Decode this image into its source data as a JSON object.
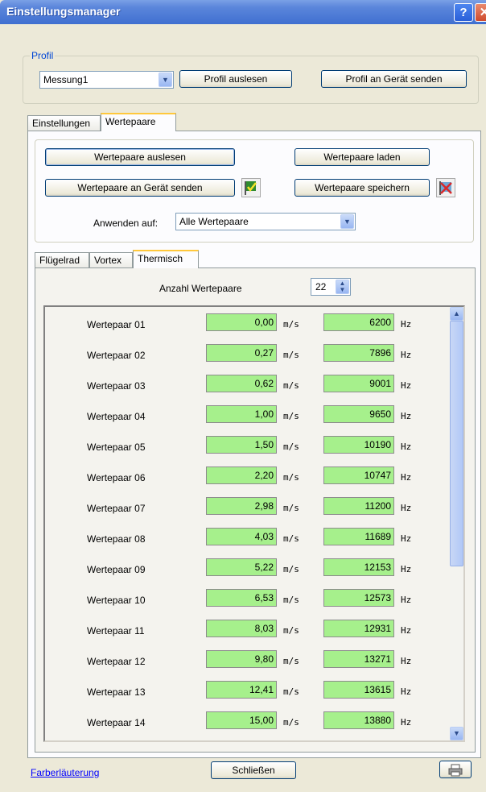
{
  "window": {
    "title": "Einstellungsmanager",
    "help_label": "?",
    "close_label": "✕"
  },
  "profile": {
    "legend": "Profil",
    "selected": "Messung1",
    "read_button": "Profil auslesen",
    "send_button": "Profil an Gerät senden"
  },
  "tabs": [
    {
      "label": "Einstellungen"
    },
    {
      "label": "Wertepaare"
    }
  ],
  "wertepaare": {
    "read_button": "Wertepaare auslesen",
    "load_button": "Wertepaare laden",
    "send_button": "Wertepaare an Gerät senden",
    "save_button": "Wertepaare speichern",
    "apply_label": "Anwenden auf:",
    "apply_value": "Alle Wertepaare"
  },
  "subtabs": [
    {
      "label": "Flügelrad"
    },
    {
      "label": "Vortex"
    },
    {
      "label": "Thermisch"
    }
  ],
  "thermisch": {
    "count_label": "Anzahl Wertepaare",
    "count_value": "22",
    "rows": [
      {
        "label": "Wertepaar 01",
        "v1": "0,00",
        "u1": "m/s",
        "v2": "6200",
        "u2": "Hz"
      },
      {
        "label": "Wertepaar 02",
        "v1": "0,27",
        "u1": "m/s",
        "v2": "7896",
        "u2": "Hz"
      },
      {
        "label": "Wertepaar 03",
        "v1": "0,62",
        "u1": "m/s",
        "v2": "9001",
        "u2": "Hz"
      },
      {
        "label": "Wertepaar 04",
        "v1": "1,00",
        "u1": "m/s",
        "v2": "9650",
        "u2": "Hz"
      },
      {
        "label": "Wertepaar 05",
        "v1": "1,50",
        "u1": "m/s",
        "v2": "10190",
        "u2": "Hz"
      },
      {
        "label": "Wertepaar 06",
        "v1": "2,20",
        "u1": "m/s",
        "v2": "10747",
        "u2": "Hz"
      },
      {
        "label": "Wertepaar 07",
        "v1": "2,98",
        "u1": "m/s",
        "v2": "11200",
        "u2": "Hz"
      },
      {
        "label": "Wertepaar 08",
        "v1": "4,03",
        "u1": "m/s",
        "v2": "11689",
        "u2": "Hz"
      },
      {
        "label": "Wertepaar 09",
        "v1": "5,22",
        "u1": "m/s",
        "v2": "12153",
        "u2": "Hz"
      },
      {
        "label": "Wertepaar 10",
        "v1": "6,53",
        "u1": "m/s",
        "v2": "12573",
        "u2": "Hz"
      },
      {
        "label": "Wertepaar 11",
        "v1": "8,03",
        "u1": "m/s",
        "v2": "12931",
        "u2": "Hz"
      },
      {
        "label": "Wertepaar 12",
        "v1": "9,80",
        "u1": "m/s",
        "v2": "13271",
        "u2": "Hz"
      },
      {
        "label": "Wertepaar 13",
        "v1": "12,41",
        "u1": "m/s",
        "v2": "13615",
        "u2": "Hz"
      },
      {
        "label": "Wertepaar 14",
        "v1": "15,00",
        "u1": "m/s",
        "v2": "13880",
        "u2": "Hz"
      }
    ]
  },
  "footer": {
    "legend_link": "Farberläuterung",
    "close_button": "Schließen"
  },
  "icons": {
    "send_status": "check-flag-icon",
    "save_status": "cross-flag-icon",
    "print": "printer-icon"
  }
}
